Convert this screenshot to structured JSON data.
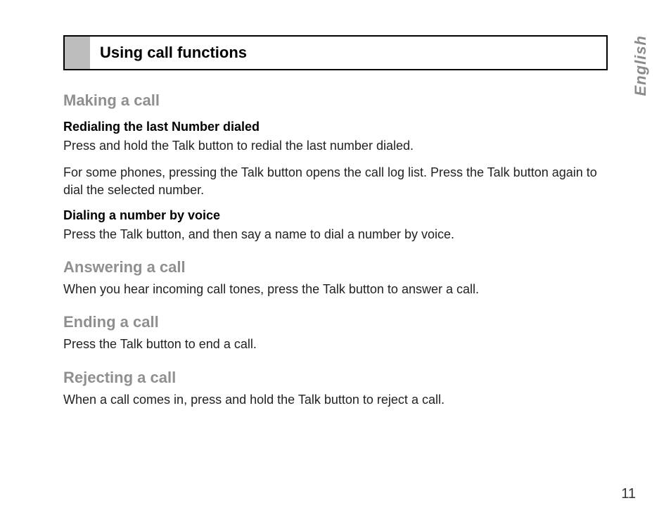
{
  "language_tab": "English",
  "page_number": "11",
  "section_title": "Using call functions",
  "sections": [
    {
      "heading": "Making a call",
      "blocks": [
        {
          "subheading": "Redialing the last Number dialed",
          "paragraphs": [
            "Press and hold the Talk button to redial the last number dialed.",
            "For some phones, pressing the Talk button opens the call log list. Press the Talk button again to dial the selected number."
          ]
        },
        {
          "subheading": "Dialing a number by voice",
          "paragraphs": [
            "Press the Talk button, and then say a name to dial a number by voice."
          ]
        }
      ]
    },
    {
      "heading": "Answering a call",
      "blocks": [
        {
          "paragraphs": [
            "When you hear incoming call tones, press the Talk button to answer a call."
          ]
        }
      ]
    },
    {
      "heading": "Ending a call",
      "blocks": [
        {
          "paragraphs": [
            "Press the Talk button to end a call."
          ]
        }
      ]
    },
    {
      "heading": "Rejecting a call",
      "blocks": [
        {
          "paragraphs": [
            "When a call comes in, press and hold the Talk button to reject a call."
          ]
        }
      ]
    }
  ]
}
